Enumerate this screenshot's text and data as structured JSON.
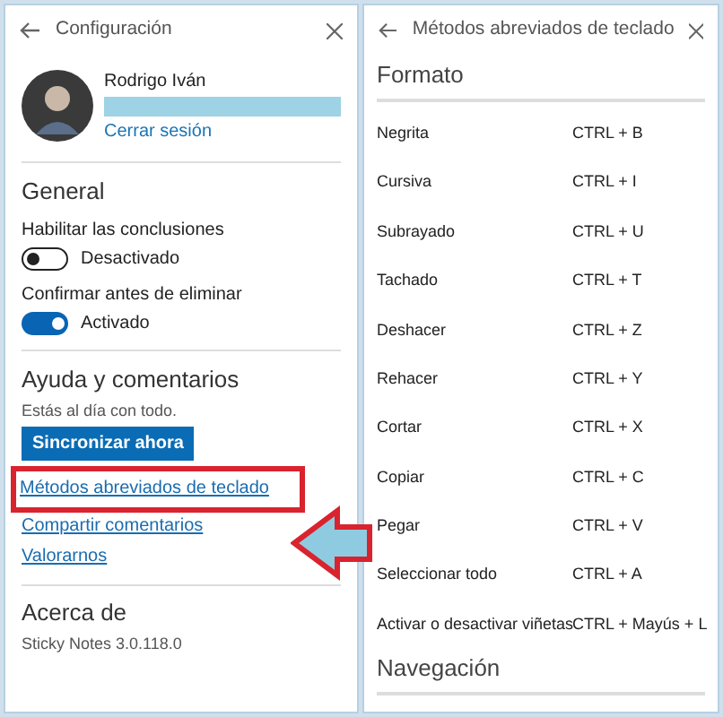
{
  "settings": {
    "title": "Configuración",
    "account": {
      "name": "Rodrigo Iván",
      "sign_out": "Cerrar sesión"
    },
    "general": {
      "heading": "General",
      "options": [
        {
          "label": "Habilitar las conclusiones",
          "on": false,
          "state_text": "Desactivado"
        },
        {
          "label": "Confirmar antes de eliminar",
          "on": true,
          "state_text": "Activado"
        }
      ]
    },
    "help": {
      "heading": "Ayuda y comentarios",
      "status": "Estás al día con todo.",
      "sync_button": "Sincronizar ahora",
      "links": [
        {
          "label": "Métodos abreviados de teclado",
          "highlighted": true
        },
        {
          "label": "Compartir comentarios",
          "highlighted": false
        },
        {
          "label": "Valorarnos",
          "highlighted": false
        }
      ]
    },
    "about": {
      "heading": "Acerca de",
      "version": "Sticky Notes 3.0.118.0"
    }
  },
  "shortcuts": {
    "title": "Métodos abreviados de teclado",
    "sections": [
      {
        "heading": "Formato",
        "rows": [
          {
            "action": "Negrita",
            "keys": "CTRL + B"
          },
          {
            "action": "Cursiva",
            "keys": "CTRL + I"
          },
          {
            "action": "Subrayado",
            "keys": "CTRL + U"
          },
          {
            "action": "Tachado",
            "keys": "CTRL + T"
          },
          {
            "action": "Deshacer",
            "keys": "CTRL + Z"
          },
          {
            "action": "Rehacer",
            "keys": "CTRL + Y"
          },
          {
            "action": "Cortar",
            "keys": "CTRL + X"
          },
          {
            "action": "Copiar",
            "keys": "CTRL + C"
          },
          {
            "action": "Pegar",
            "keys": "CTRL + V"
          },
          {
            "action": "Seleccionar todo",
            "keys": "CTRL + A"
          },
          {
            "action": "Activar o desactivar viñetas",
            "keys": "CTRL + Mayús + L"
          }
        ]
      },
      {
        "heading": "Navegación"
      }
    ]
  }
}
